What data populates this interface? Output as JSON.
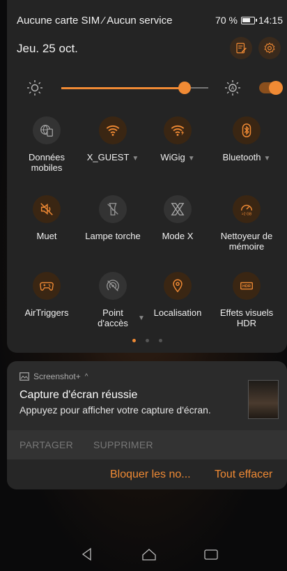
{
  "status_bar": {
    "carrier": "Aucune carte SIM ⁄ Aucun service",
    "battery": "70 %",
    "time": "14:15"
  },
  "header": {
    "date": "Jeu. 25 oct.",
    "edit_icon": "edit-icon",
    "settings_icon": "gear-icon"
  },
  "brightness": {
    "level": 0.84,
    "auto_enabled": true
  },
  "tiles": [
    {
      "label": "Données mobiles",
      "icon": "mobile-data-icon",
      "on": false,
      "has_menu": false
    },
    {
      "label": "X_GUEST",
      "icon": "wifi-icon",
      "on": true,
      "has_menu": true
    },
    {
      "label": "WiGig",
      "icon": "wigig-icon",
      "on": true,
      "has_menu": true
    },
    {
      "label": "Bluetooth",
      "icon": "bluetooth-icon",
      "on": true,
      "has_menu": true
    },
    {
      "label": "Muet",
      "icon": "mute-icon",
      "on": true,
      "has_menu": false
    },
    {
      "label": "Lampe torche",
      "icon": "flashlight-icon",
      "on": false,
      "has_menu": false
    },
    {
      "label": "Mode X",
      "icon": "mode-x-icon",
      "on": false,
      "has_menu": false
    },
    {
      "label": "Nettoyeur de mémoire",
      "icon": "memory-cleaner-icon",
      "on": true,
      "has_menu": false,
      "badge": ">2 GB"
    },
    {
      "label": "AirTriggers",
      "icon": "gamepad-icon",
      "on": true,
      "has_menu": false
    },
    {
      "label": "Point d'accès",
      "icon": "hotspot-icon",
      "on": false,
      "has_menu": true
    },
    {
      "label": "Localisation",
      "icon": "location-icon",
      "on": true,
      "has_menu": false
    },
    {
      "label": "Effets visuels HDR",
      "icon": "hdr-icon",
      "on": true,
      "has_menu": false,
      "badge": "HDR"
    }
  ],
  "page_dots": {
    "count": 3,
    "active": 0
  },
  "notification": {
    "app_name": "Screenshot+",
    "title": "Capture d'écran réussie",
    "text": "Appuyez pour afficher votre capture d'écran.",
    "actions": [
      "PARTAGER",
      "SUPPRIMER"
    ]
  },
  "footer": {
    "block_label": "Bloquer les no...",
    "clear_label": "Tout effacer"
  },
  "colors": {
    "accent": "#f08a34",
    "shade": "#242424"
  }
}
